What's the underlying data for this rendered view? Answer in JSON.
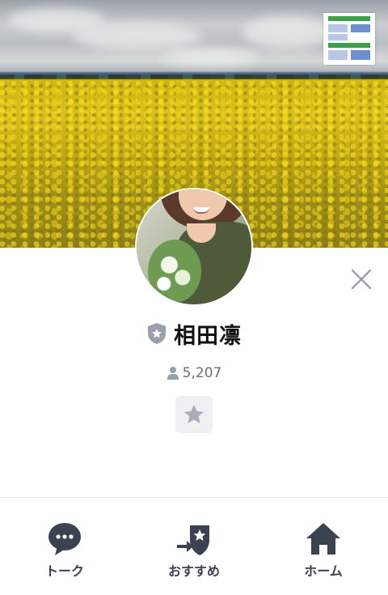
{
  "profile": {
    "name": "相田凛",
    "friend_count": "5,207"
  },
  "nav": {
    "items": [
      {
        "label": "トーク",
        "icon": "chat-bubble-icon"
      },
      {
        "label": "おすすめ",
        "icon": "recommend-icon"
      },
      {
        "label": "ホーム",
        "icon": "home-icon"
      }
    ]
  },
  "icons": {
    "close": "close-icon",
    "badge": "official-badge-icon",
    "friends": "person-icon",
    "favorite": "star-icon"
  },
  "colors": {
    "nav_icon": "#3b4250",
    "badge": "#9aa0aa",
    "star_button_bg": "#eef0f2",
    "star": "#a9adb7"
  }
}
